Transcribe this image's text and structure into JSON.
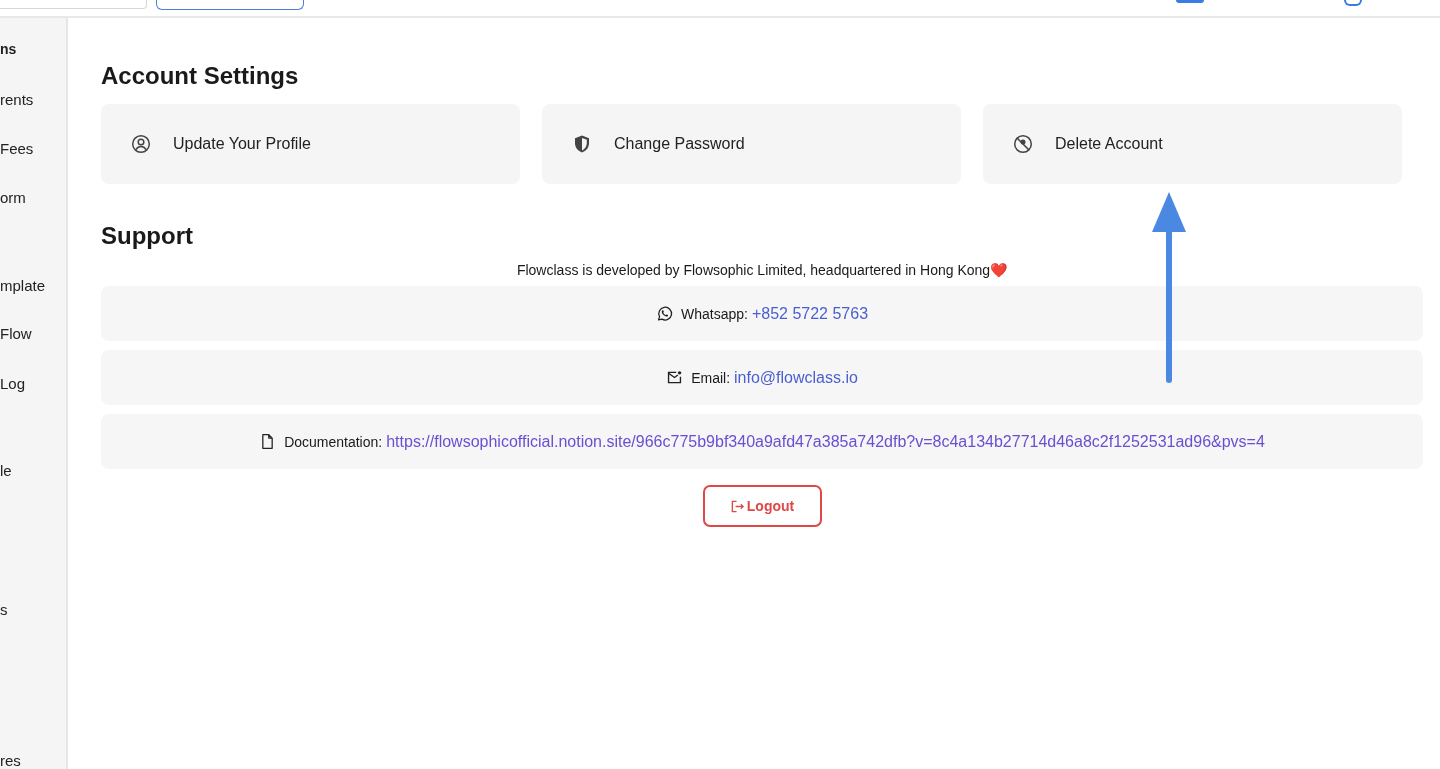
{
  "sidebar": {
    "items": [
      {
        "label": "ns",
        "kind": "header"
      },
      {
        "label": "rents",
        "kind": "item"
      },
      {
        "label": "Fees",
        "kind": "item"
      },
      {
        "label": "orm",
        "kind": "item"
      },
      {
        "label": "mplate",
        "kind": "item"
      },
      {
        "label": "Flow",
        "kind": "item"
      },
      {
        "label": "Log",
        "kind": "item"
      },
      {
        "label": "le",
        "kind": "item"
      },
      {
        "label": "s",
        "kind": "item"
      },
      {
        "label": "res",
        "kind": "item"
      }
    ]
  },
  "account_settings": {
    "title": "Account Settings",
    "cards": [
      {
        "label": "Update Your Profile",
        "kind": "profile"
      },
      {
        "label": "Change Password",
        "kind": "password"
      },
      {
        "label": "Delete Account",
        "kind": "delete"
      }
    ]
  },
  "support": {
    "title": "Support",
    "note": "Flowclass is developed by Flowsophic Limited, headquartered in Hong Kong❤️",
    "rows": [
      {
        "kind": "whatsapp",
        "label": "Whatsapp:",
        "link": "+852 5722 5763"
      },
      {
        "kind": "email",
        "label": "Email:",
        "link": "info@flowclass.io"
      },
      {
        "kind": "docs",
        "label": "Documentation:",
        "link": "https://flowsophicofficial.notion.site/966c775b9bf340a9afd47a385a742dfb?v=8c4a134b27714d46a8c2f1252531ad96&pvs=4"
      }
    ]
  },
  "logout_button": {
    "label": "Logout"
  }
}
